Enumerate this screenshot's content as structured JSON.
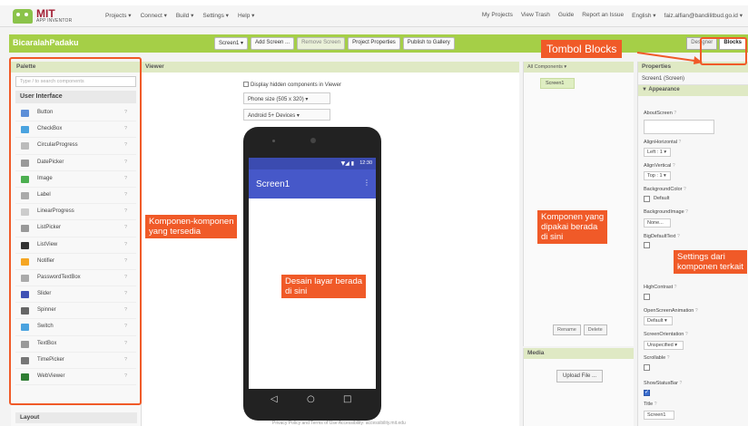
{
  "header": {
    "logo_title": "MIT",
    "logo_sub": "APP INVENTOR",
    "menu_left": [
      "Projects ▾",
      "Connect ▾",
      "Build ▾",
      "Settings ▾",
      "Help ▾"
    ],
    "menu_right": [
      "My Projects",
      "View Trash",
      "Guide",
      "Report an Issue",
      "English ▾",
      "faiz.alfian@bandilitbud.go.id ▾"
    ]
  },
  "toolbar": {
    "project_name": "BicaralahPadaku",
    "buttons": [
      "Screen1 ▾",
      "Add Screen ...",
      "Remove Screen",
      "Project Properties",
      "Publish to Gallery"
    ],
    "designer_label": "Designer",
    "blocks_label": "Blocks"
  },
  "palette": {
    "title": "Palette",
    "search_placeholder": "Type / to search components",
    "category": "User Interface",
    "items": [
      {
        "label": "Button",
        "color": "#5d8fd8"
      },
      {
        "label": "CheckBox",
        "color": "#4aa3df"
      },
      {
        "label": "CircularProgress",
        "color": "#bbbbbb"
      },
      {
        "label": "DatePicker",
        "color": "#999999"
      },
      {
        "label": "Image",
        "color": "#4caf50"
      },
      {
        "label": "Label",
        "color": "#aaaaaa"
      },
      {
        "label": "LinearProgress",
        "color": "#cccccc"
      },
      {
        "label": "ListPicker",
        "color": "#999999"
      },
      {
        "label": "ListView",
        "color": "#333333"
      },
      {
        "label": "Notifier",
        "color": "#f5a623"
      },
      {
        "label": "PasswordTextBox",
        "color": "#aaaaaa"
      },
      {
        "label": "Slider",
        "color": "#3f51b5"
      },
      {
        "label": "Spinner",
        "color": "#666666"
      },
      {
        "label": "Switch",
        "color": "#4aa3df"
      },
      {
        "label": "TextBox",
        "color": "#999999"
      },
      {
        "label": "TimePicker",
        "color": "#777777"
      },
      {
        "label": "WebViewer",
        "color": "#2e7d32"
      }
    ],
    "help_mark": "?",
    "layout_label": "Layout"
  },
  "viewer": {
    "title": "Viewer",
    "hidden_checkbox_label": "Display hidden components in Viewer",
    "size_select": "Phone size (505 x 320)  ▾",
    "device_select": "Android 5+ Devices  ▾",
    "status_time": "12:30",
    "status_icons": "▼◢ ▮",
    "screen_title": "Screen1",
    "menu_dots": "⋮",
    "nav_back": "◁",
    "nav_home": "○",
    "nav_recent": "□"
  },
  "components": {
    "title": "All Components ▾",
    "tree_root": "Screen1",
    "rename_label": "Rename",
    "delete_label": "Delete",
    "media_title": "Media",
    "upload_label": "Upload File ..."
  },
  "properties": {
    "title": "Properties",
    "screen_name": "Screen1 (Screen)",
    "section": "▼ Appearance",
    "about_screen": "AboutScreen",
    "align_horizontal": "AlignHorizontal",
    "align_horizontal_value": "Left : 1 ▾",
    "align_vertical": "AlignVertical",
    "align_vertical_value": "Top : 1 ▾",
    "background_color": "BackgroundColor",
    "background_color_value": "Default",
    "background_image": "BackgroundImage",
    "background_image_value": "None...",
    "big_default_text": "BigDefaultText",
    "high_contrast": "HighContrast",
    "open_screen_animation": "OpenScreenAnimation",
    "open_screen_animation_value": "Default ▾",
    "screen_orientation": "ScreenOrientation",
    "screen_orientation_value": "Unspecified ▾",
    "scrollable": "Scrollable",
    "show_status_bar": "ShowStatusBar",
    "title_label": "Title",
    "title_value": "Screen1",
    "help_mark": "?"
  },
  "footer": {
    "text": "Privacy Policy and Terms of Use    Accessibility: accessibility.mit.edu"
  },
  "annotations": {
    "palette_callout": "Komponen-komponen\nyang tersedia",
    "viewer_callout": "Desain layar berada\ndi sini",
    "components_callout": "Komponen yang\ndipakai berada\ndi sini",
    "properties_callout": "Settings dari\nkomponen terkait",
    "blocks_callout": "Tombol Blocks",
    "callout_color": "#f05a28"
  }
}
